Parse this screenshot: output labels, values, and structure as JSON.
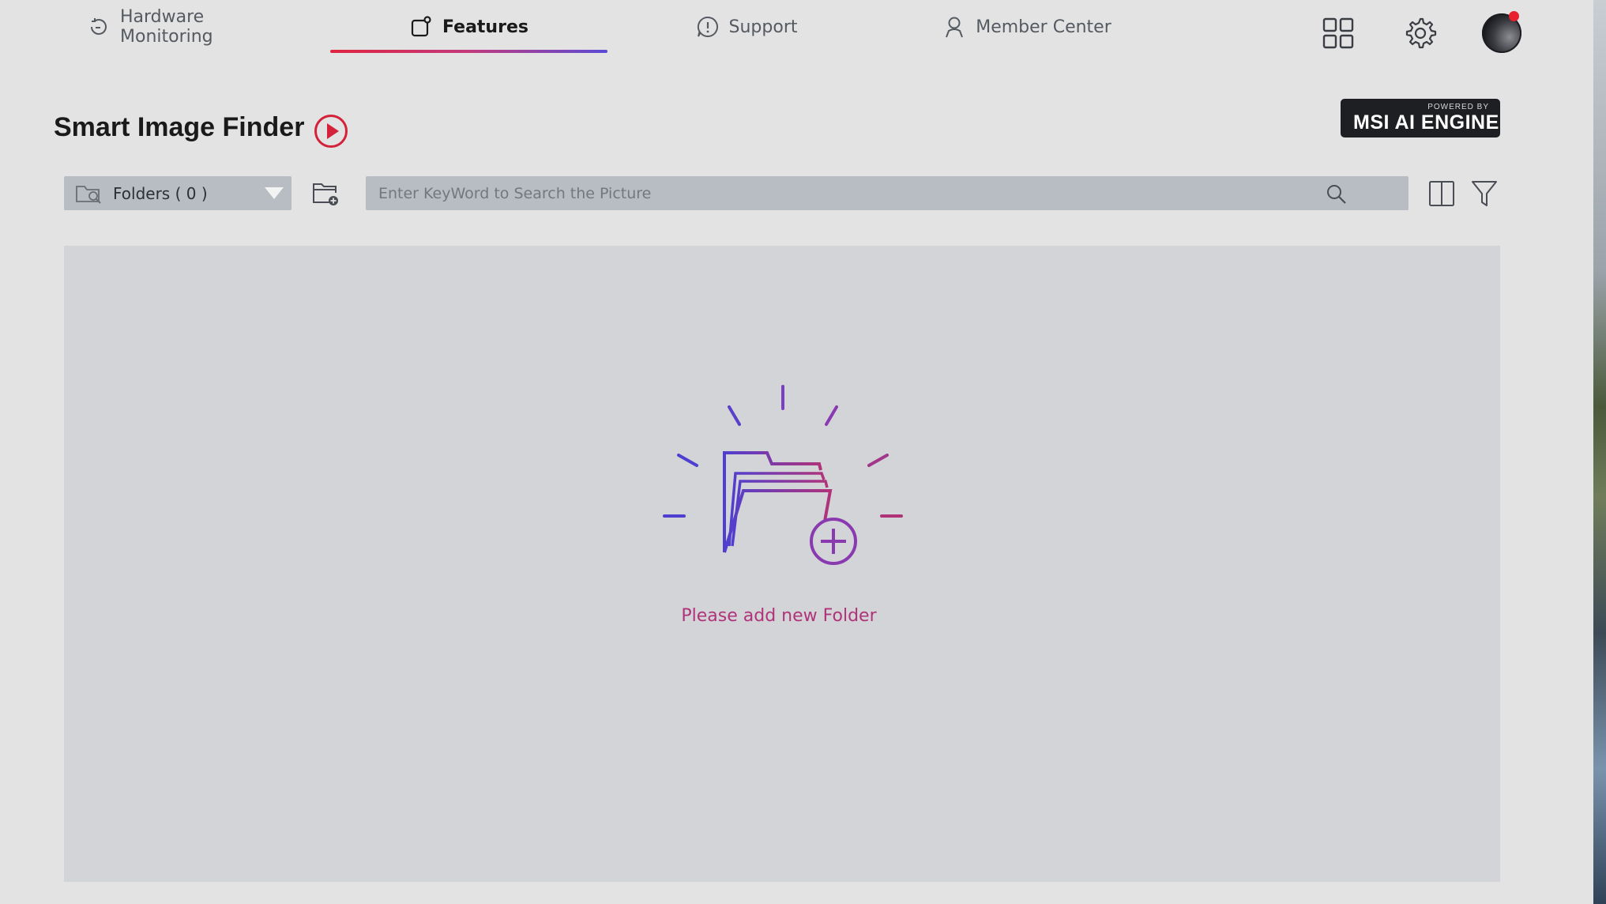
{
  "nav": {
    "items": [
      {
        "label": "Hardware Monitoring",
        "icon": "gauge-icon"
      },
      {
        "label": "Features",
        "icon": "features-icon",
        "active": true
      },
      {
        "label": "Support",
        "icon": "support-icon"
      },
      {
        "label": "Member Center",
        "icon": "user-icon"
      }
    ]
  },
  "top_icons": [
    "grid-icon",
    "gear-icon"
  ],
  "page": {
    "title": "Smart Image Finder"
  },
  "badge": {
    "small": "POWERED BY",
    "big": "MSI AI ENGINE"
  },
  "toolbar": {
    "folder_select_label": "Folders ( 0 )",
    "search_placeholder": "Enter KeyWord to Search the Picture"
  },
  "empty_state": {
    "message": "Please add new Folder"
  },
  "colors": {
    "accent_red": "#e0243f",
    "accent_purple": "#5a4bd6",
    "empty_text": "#b0337a"
  }
}
